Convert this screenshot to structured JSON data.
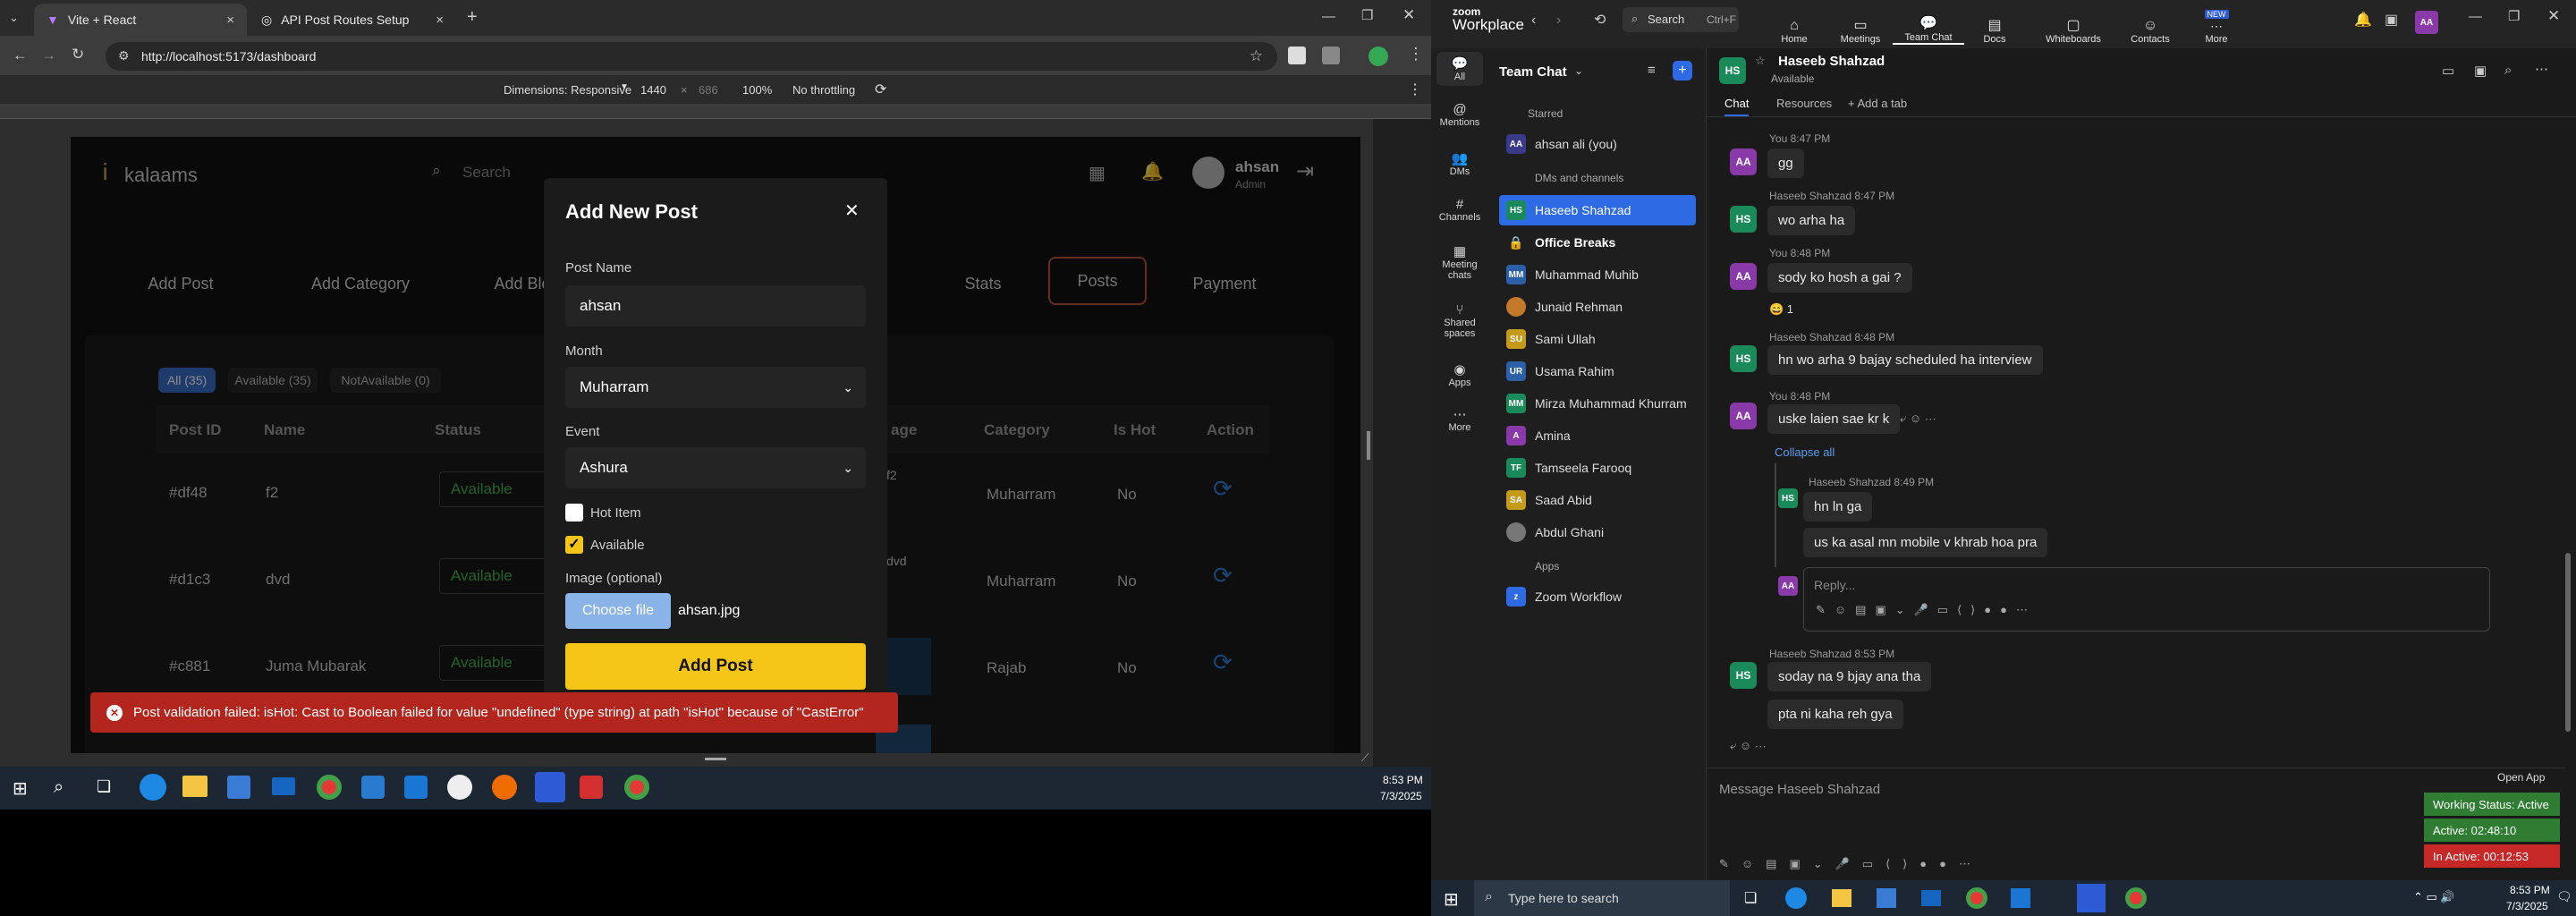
{
  "chrome": {
    "tabs": [
      {
        "title": "Vite + React",
        "close": "×"
      },
      {
        "title": "API Post Routes Setup",
        "close": "×"
      }
    ],
    "new_tab": "+",
    "url": "http://localhost:5173/dashboard",
    "devtools": {
      "dimensions_label": "Dimensions: Responsive",
      "width": "1440",
      "height": "686",
      "zoom": "100%",
      "throttle": "No throttling"
    }
  },
  "app": {
    "logo": "kalaams",
    "search_placeholder": "Search",
    "user_name": "ahsan",
    "user_role": "Admin",
    "nav": [
      "Add Post",
      "Add Category",
      "Add Blog",
      "Stats",
      "Posts",
      "Payment"
    ],
    "filters": [
      "All (35)",
      "Available (35)",
      "NotAvailable (0)"
    ],
    "table": {
      "headers": [
        "Post ID",
        "Name",
        "Status",
        "Image",
        "Category",
        "Is Hot",
        "Action"
      ],
      "image_partial_header": "age",
      "rows": [
        {
          "id": "#df48",
          "name": "f2",
          "status": "Available",
          "image_text": "f2",
          "category": "Muharram",
          "hot": "No"
        },
        {
          "id": "#d1c3",
          "name": "dvd",
          "status": "Available",
          "image_text": "dvd",
          "category": "Muharram",
          "hot": "No"
        },
        {
          "id": "#c881",
          "name": "Juma Mubarak",
          "status": "Available",
          "image_text": "",
          "category": "Rajab",
          "hot": "No"
        }
      ]
    }
  },
  "modal": {
    "title": "Add New Post",
    "close": "✕",
    "post_name_label": "Post Name",
    "post_name_value": "ahsan",
    "month_label": "Month",
    "month_value": "Muharram",
    "event_label": "Event",
    "event_value": "Ashura",
    "hot_item_label": "Hot Item",
    "hot_item_checked": false,
    "available_label": "Available",
    "available_checked": true,
    "image_label": "Image (optional)",
    "choose_file": "Choose file",
    "file_name": "ahsan.jpg",
    "submit": "Add Post"
  },
  "toast": {
    "message": "Post validation failed: isHot: Cast to Boolean failed for value \"undefined\" (type string) at path \"isHot\" because of \"CastError\""
  },
  "taskbar_left": {
    "time": "8:53 PM",
    "date": "7/3/2025"
  },
  "zoom": {
    "brand_top": "zoom",
    "brand": "Workplace",
    "search": "Search",
    "search_shortcut": "Ctrl+F",
    "top_nav": [
      "Home",
      "Meetings",
      "Team Chat",
      "Docs",
      "Whiteboards",
      "Contacts",
      "More"
    ],
    "new_badge": "NEW",
    "side": [
      "All",
      "Mentions",
      "DMs",
      "Channels",
      "Meeting chats",
      "Shared spaces",
      "Apps",
      "More"
    ],
    "list_title": "Team Chat",
    "sections": {
      "starred": "Starred",
      "dms": "DMs and channels",
      "apps": "Apps"
    },
    "starred": [
      {
        "name": "ahsan ali (you)",
        "initials": "AA"
      }
    ],
    "contacts": [
      {
        "name": "Haseeb Shahzad",
        "initials": "HS",
        "color": "#1a8a5a"
      },
      {
        "name": "Office Breaks",
        "initials": "",
        "color": "#2a2a2a"
      },
      {
        "name": "Muhammad Muhib",
        "initials": "MM",
        "color": "#2b5fa8"
      },
      {
        "name": "Junaid Rehman",
        "initials": "",
        "color": "#c27a2a"
      },
      {
        "name": "Sami Ullah",
        "initials": "SU",
        "color": "#c49a1a"
      },
      {
        "name": "Usama Rahim",
        "initials": "UR",
        "color": "#2b5fa8"
      },
      {
        "name": "Mirza Muhammad Khurram",
        "initials": "MM",
        "color": "#1a8a5a"
      },
      {
        "name": "Amina",
        "initials": "A",
        "color": "#8a3aa8"
      },
      {
        "name": "Tamseela Farooq",
        "initials": "TF",
        "color": "#1a8a5a"
      },
      {
        "name": "Saad Abid",
        "initials": "SA",
        "color": "#c49a1a"
      },
      {
        "name": "Abdul Ghani",
        "initials": "",
        "color": "#777777"
      }
    ],
    "apps": [
      {
        "name": "Zoom Workflow"
      }
    ],
    "chat": {
      "name": "Haseeb Shahzad",
      "initials": "HS",
      "status": "Available",
      "tabs": [
        "Chat",
        "Resources",
        "+ Add a tab"
      ],
      "messages": [
        {
          "meta": "You 8:47 PM",
          "text": "gg",
          "who": "AA"
        },
        {
          "meta": "Haseeb Shahzad 8:47 PM",
          "text": "wo arha ha",
          "who": "HS"
        },
        {
          "meta": "You 8:48 PM",
          "text": "sody ko hosh a gai ?",
          "who": "AA"
        },
        {
          "meta": "Haseeb Shahzad 8:48 PM",
          "text": "hn wo arha 9 bajay scheduled ha interview",
          "who": "HS"
        },
        {
          "meta": "You 8:48 PM",
          "text": "uske laien sae kr k",
          "who": "AA"
        },
        {
          "meta": "Haseeb Shahzad 8:49 PM",
          "text": "hn ln ga",
          "who": "HS"
        },
        {
          "meta": "",
          "text": "us ka asal mn mobile v khrab hoa pra",
          "who": ""
        },
        {
          "meta": "Haseeb Shahzad 8:53 PM",
          "text": "soday na 9 bjay ana tha",
          "who": "HS"
        },
        {
          "meta": "",
          "text": "pta ni kaha reh gya",
          "who": ""
        }
      ],
      "reaction": "😄 1",
      "collapse": "Collapse all",
      "reply_placeholder": "Reply...",
      "message_placeholder": "Message Haseeb Shahzad",
      "open_app": "Open App"
    },
    "work_status": [
      "Working Status: Active",
      "Active: 02:48:10",
      "In Active: 00:12:53"
    ],
    "work_colors": [
      "#2e7d32",
      "#2e7d32",
      "#c62828"
    ]
  },
  "taskbar_right": {
    "search": "Type here to search",
    "time": "8:53 PM",
    "date": "7/3/2025"
  }
}
